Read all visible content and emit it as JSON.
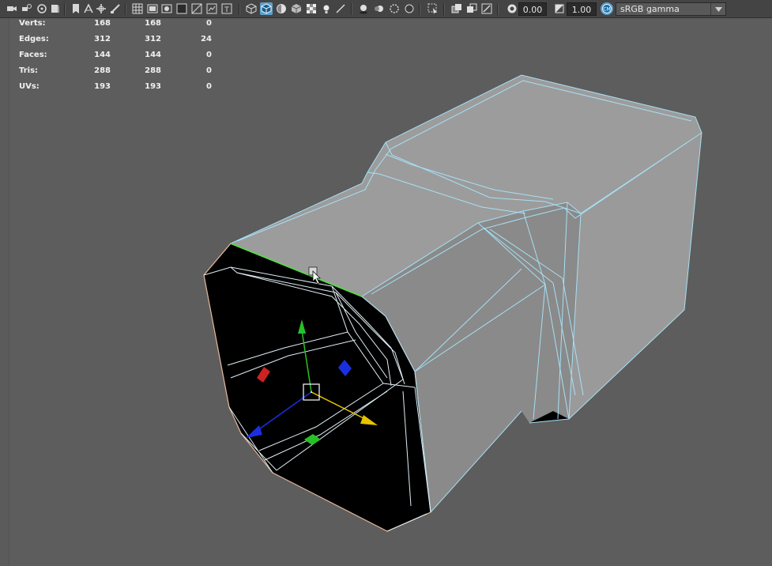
{
  "toolbar": {
    "exposure_value": "0.00",
    "gamma_value": "1.00",
    "color_space": "sRGB gamma",
    "icons": [
      "camera-icon",
      "camera-attr-icon",
      "bookmark-icon",
      "image-plane-icon",
      "grease-pencil-icon",
      "grid-icon",
      "film-gate-icon",
      "resolution-gate-icon",
      "safe-action-icon",
      "field-chart-icon",
      "wireframe-icon",
      "smooth-shade-icon",
      "shade-all-icon",
      "textured-icon",
      "lights-icon",
      "shadows-icon",
      "xray-icon",
      "isolate-icon",
      "exposure-icon",
      "gamma-icon",
      "color-management-icon"
    ],
    "active_color": "#5e9fc9"
  },
  "hud": {
    "rows": [
      {
        "label": "Verts:",
        "v1": "168",
        "v2": "168",
        "v3": "0"
      },
      {
        "label": "Edges:",
        "v1": "312",
        "v2": "312",
        "v3": "24"
      },
      {
        "label": "Faces:",
        "v1": "144",
        "v2": "144",
        "v3": "0"
      },
      {
        "label": "Tris:",
        "v1": "288",
        "v2": "288",
        "v3": "0"
      },
      {
        "label": "UVs:",
        "v1": "193",
        "v2": "193",
        "v3": "0"
      }
    ]
  },
  "viewport": {
    "background": "#5d5d5d",
    "mesh_face": "#999999",
    "wire": "#a6e0f5",
    "selected_edge": "#5bd64c",
    "selected_face_outline": "#e8b89a",
    "gizmo": {
      "x": "#e8c200",
      "y": "#28c028",
      "z": "#1a30e0"
    }
  }
}
